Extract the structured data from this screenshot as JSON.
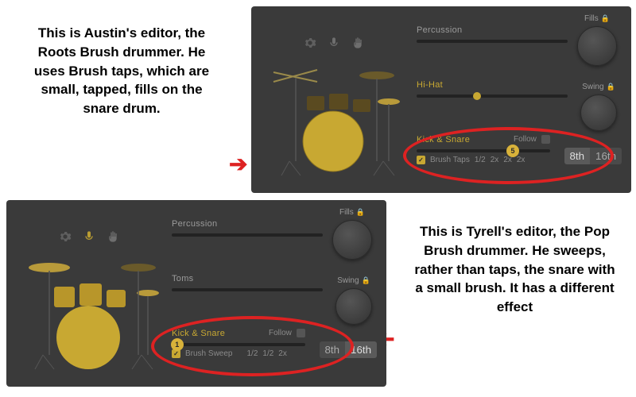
{
  "commentary": {
    "austin": "This is Austin's editor, the Roots Brush drummer. He uses Brush taps, which are small, tapped, fills on the snare drum.",
    "tyrell": "This is Tyrell's editor, the Pop Brush drummer. He sweeps, rather than taps, the snare with a small brush. It has a different effect"
  },
  "labels": {
    "percussion": "Percussion",
    "hihat": "Hi-Hat",
    "toms": "Toms",
    "kicksnare": "Kick & Snare",
    "follow": "Follow",
    "fills": "Fills",
    "swing": "Swing",
    "brush_taps": "Brush Taps",
    "brush_sweep": "Brush Sweep"
  },
  "austin": {
    "hihat_pos_pct": 40,
    "kicksnare_pos_pct": 72,
    "kicksnare_badge": "5",
    "rates": [
      "1/2",
      "2x",
      "2x",
      "2x"
    ]
  },
  "tyrell": {
    "percussion_pos_pct": 0,
    "toms_pos_pct": 0,
    "kicksnare_pos_pct": 4,
    "kicksnare_badge": "1",
    "rates": [
      "1/2",
      "1/2",
      "2x"
    ]
  },
  "segments": {
    "eighth": "8th",
    "sixteenth": "16th"
  },
  "icons": {
    "gear": "gear-icon",
    "mic": "mic-icon",
    "hand": "hand-icon",
    "lock": "lock-icon"
  },
  "colors": {
    "accent": "#c8a832",
    "annotation": "#d22",
    "panel": "#3a3a3a"
  }
}
